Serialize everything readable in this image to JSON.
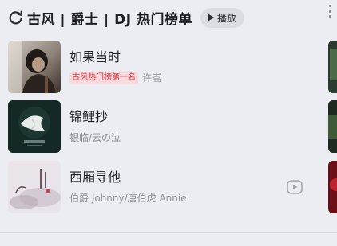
{
  "header": {
    "title": "古风 | 爵士 | DJ 热门榜单",
    "play_label": "播放"
  },
  "songs": [
    {
      "name": "如果当时",
      "badge": "古风热门榜第一名",
      "artist": "许嵩"
    },
    {
      "name": "锦鲤抄",
      "badge": "",
      "artist": "银临/云の泣"
    },
    {
      "name": "西厢寻他",
      "badge": "",
      "artist": "伯爵 Johnny/唐伯虎 Annie"
    }
  ],
  "colors": {
    "background": "#ecedf2",
    "badge_text": "#e0313b",
    "badge_bg": "#f9dadd"
  }
}
